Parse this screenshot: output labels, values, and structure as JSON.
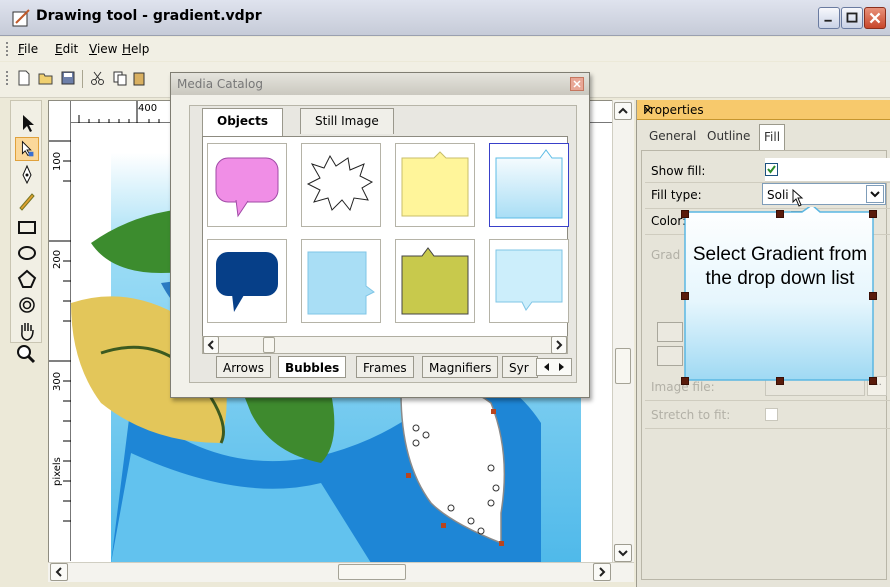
{
  "window": {
    "title": "Drawing tool - gradient.vdpr"
  },
  "menu": {
    "items": [
      "File",
      "Edit",
      "View",
      "Help"
    ]
  },
  "ruler": {
    "top_numbers": [
      "400"
    ],
    "left_numbers": [
      "100",
      "200",
      "300"
    ],
    "unit_label": "pixels"
  },
  "media_catalog": {
    "title": "Media Catalog",
    "top_tabs": [
      "Objects",
      "Still Image"
    ],
    "active_top_tab": "Objects",
    "bottom_tabs": [
      "Arrows",
      "Bubbles",
      "Frames",
      "Magnifiers",
      "Syr"
    ],
    "active_bottom_tab": "Bubbles",
    "thumbnails": [
      {
        "name": "pink-speech-bubble",
        "color": "#f08ee6"
      },
      {
        "name": "burst-bubble",
        "color": "#ffffff"
      },
      {
        "name": "yellow-note-bubble",
        "color": "#fff59a"
      },
      {
        "name": "gradient-note-bubble",
        "color": "#cdeefa"
      },
      {
        "name": "navy-speech-bubble",
        "color": "#063f88"
      },
      {
        "name": "light-blue-callout",
        "color": "#a9def5"
      },
      {
        "name": "olive-note-bubble",
        "color": "#c8c94c"
      },
      {
        "name": "pale-blue-callout",
        "color": "#cceefb"
      }
    ]
  },
  "properties": {
    "title": "Properties",
    "close_glyph": "×",
    "tabs": [
      "General",
      "Outline",
      "Fill"
    ],
    "active_tab": "Fill",
    "rows": {
      "show_fill_label": "Show fill:",
      "fill_type_label": "Fill type:",
      "fill_type_value": "Soli",
      "color_label": "Color:",
      "gradient_label": "Grad",
      "image_file_label": "Image file:",
      "image_file_button": "...",
      "stretch_label": "Stretch to fit:"
    },
    "show_fill_checked": true
  },
  "callout": {
    "text": "Select Gradient from the drop down list"
  },
  "colors": {
    "accent_header": "#f7c96c",
    "canvas_sky": "#6ec8f0",
    "canvas_blue": "#1e88d8",
    "leaf_green": "#3f8a2f",
    "leaf_yellow": "#e2c95a"
  }
}
